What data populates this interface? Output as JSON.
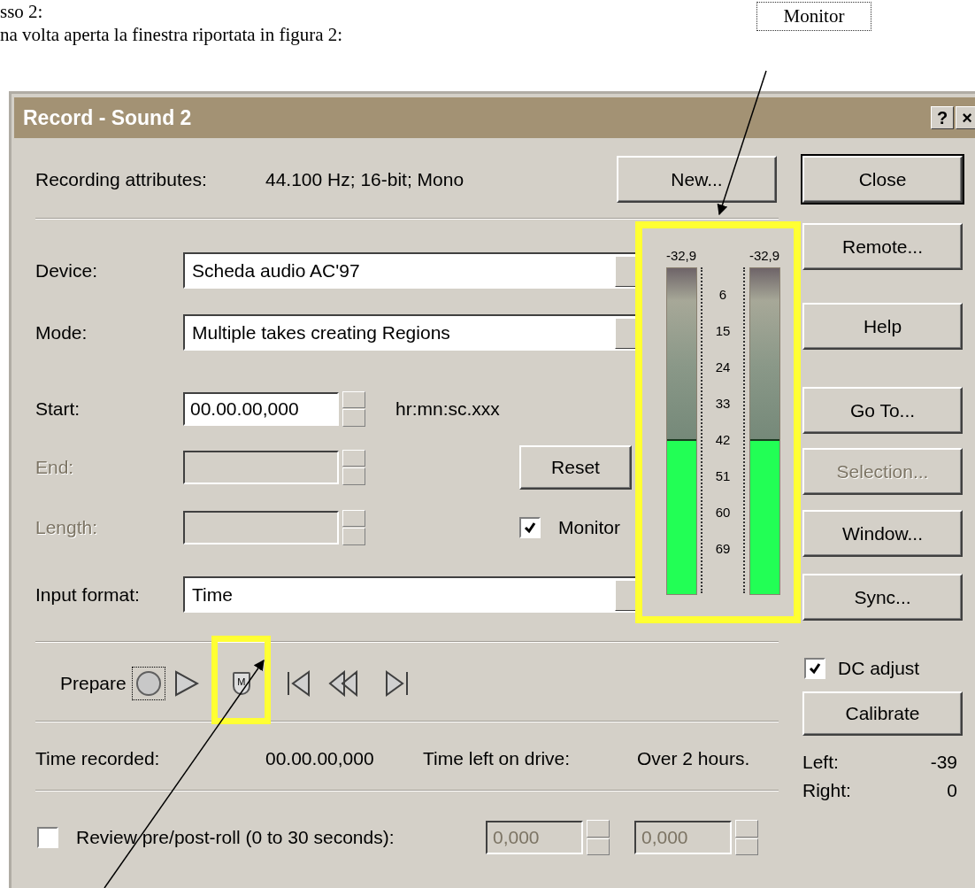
{
  "document": {
    "lines": [
      "sso 2:",
      "na volta aperta la finestra riportata in figura 2:"
    ]
  },
  "callout": {
    "label": "Monitor"
  },
  "window": {
    "title": "Record - Sound 2",
    "title_buttons": [
      "?",
      "×"
    ]
  },
  "attributes": {
    "label": "Recording attributes:",
    "value": "44.100 Hz; 16-bit; Mono",
    "button": "New..."
  },
  "fields": [
    {
      "kind": "dropdown",
      "label": "Device:",
      "value": "Scheda audio AC'97",
      "disabled": false
    },
    {
      "kind": "dropdown",
      "label": "Mode:",
      "value": "Multiple takes creating Regions",
      "disabled": false
    },
    {
      "kind": "spin",
      "label": "Start:",
      "value": "00.00.00,000",
      "hint": "hr:mn:sc.xxx",
      "disabled": false
    },
    {
      "kind": "spin",
      "label": "End:",
      "disabled": true,
      "button": "Reset"
    },
    {
      "kind": "spin",
      "label": "Length:",
      "disabled": true,
      "checkbox": {
        "label": "Monitor",
        "checked": true
      }
    },
    {
      "kind": "dropdown",
      "label": "Input format:",
      "value": "Time",
      "disabled": false
    }
  ],
  "meter": {
    "channels": [
      {
        "reading": "-32,9",
        "level": 0.47
      },
      {
        "reading": "-32,9",
        "level": 0.47
      }
    ],
    "scale": [
      "6",
      "15",
      "24",
      "33",
      "42",
      "51",
      "60",
      "69"
    ]
  },
  "transport": {
    "label": "Prepare",
    "buttons": [
      {
        "kind": "record",
        "focused": true
      },
      {
        "kind": "play",
        "focused": false
      },
      {
        "kind": "marker",
        "label": "M",
        "focused": false
      },
      {
        "kind": "go-start",
        "focused": false
      },
      {
        "kind": "rewind",
        "focused": false
      },
      {
        "kind": "go-end",
        "focused": false
      }
    ]
  },
  "status": [
    {
      "label": "Time recorded:",
      "value": "00.00.00,000"
    },
    {
      "label": "Time left on drive:",
      "value": "Over 2 hours."
    }
  ],
  "review": {
    "label": "Review pre/post-roll (0 to 30 seconds):",
    "checked": false,
    "fields": [
      {
        "value": "0,000",
        "disabled": true
      },
      {
        "value": "0,000",
        "disabled": true
      }
    ]
  },
  "side_buttons": [
    {
      "label": "Close",
      "default": true,
      "disabled": false
    },
    {
      "label": "Remote...",
      "default": false,
      "disabled": false
    },
    {
      "label": "Help",
      "default": false,
      "disabled": false
    },
    {
      "label": "Go To...",
      "default": false,
      "disabled": false
    },
    {
      "label": "Selection...",
      "default": false,
      "disabled": true
    },
    {
      "label": "Window...",
      "default": false,
      "disabled": false
    },
    {
      "label": "Sync...",
      "default": false,
      "disabled": false
    }
  ],
  "dc_adjust": {
    "label": "DC adjust",
    "checked": true
  },
  "calibrate": "Calibrate",
  "levels": [
    {
      "label": "Left:",
      "value": "-39"
    },
    {
      "label": "Right:",
      "value": "0"
    }
  ]
}
